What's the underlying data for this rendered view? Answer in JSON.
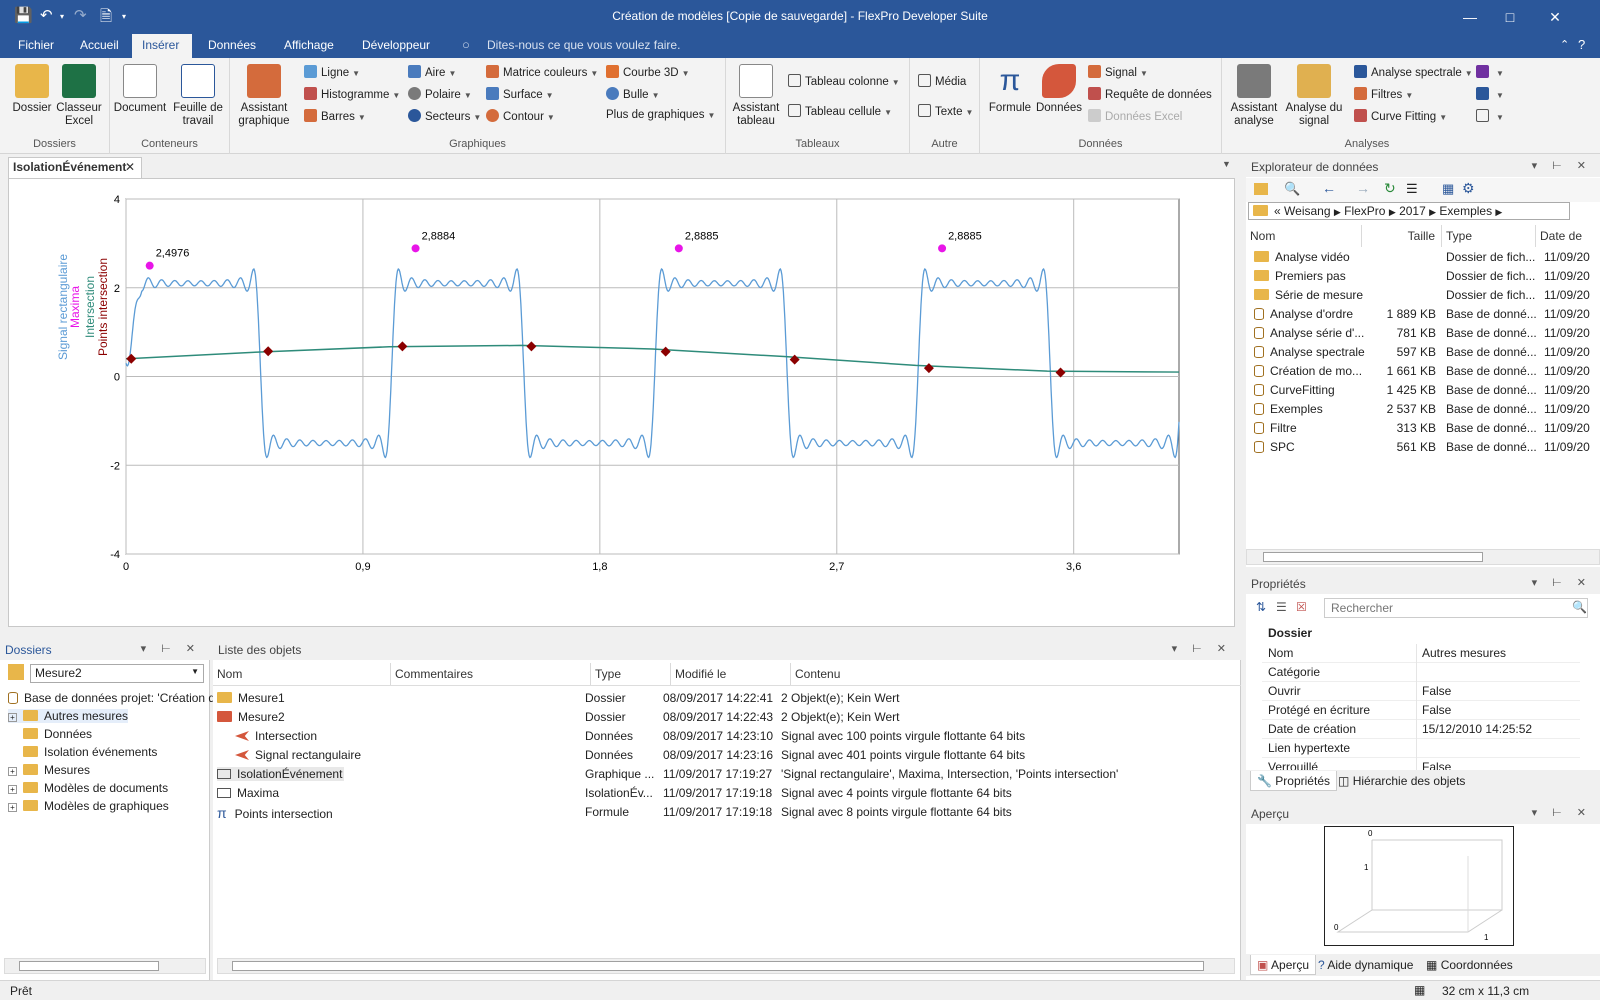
{
  "window": {
    "title": "Création de modèles [Copie de sauvegarde] - FlexPro Developer Suite"
  },
  "tabs": [
    "Fichier",
    "Accueil",
    "Insérer",
    "Données",
    "Affichage",
    "Développeur"
  ],
  "tellme": "Dites-nous ce que vous voulez faire.",
  "ribbon": {
    "dossiers": {
      "name": "Dossiers",
      "dossier": "Dossier",
      "classeur": "Classeur Excel"
    },
    "conteneurs": {
      "name": "Conteneurs",
      "document": "Document",
      "feuille": "Feuille de travail"
    },
    "graphiques": {
      "name": "Graphiques",
      "assistant": "Assistant graphique",
      "ligne": "Ligne",
      "histogramme": "Histogramme",
      "barres": "Barres",
      "aire": "Aire",
      "polaire": "Polaire",
      "secteurs": "Secteurs",
      "matrice": "Matrice couleurs",
      "surface": "Surface",
      "contour": "Contour",
      "courbe3d": "Courbe 3D",
      "bulle": "Bulle",
      "plus": "Plus de graphiques"
    },
    "tableaux": {
      "name": "Tableaux",
      "assistant": "Assistant tableau",
      "colonne": "Tableau colonne",
      "cellule": "Tableau cellule"
    },
    "autre": {
      "name": "Autre",
      "media": "Média",
      "texte": "Texte"
    },
    "donnees": {
      "name": "Données",
      "formule": "Formule",
      "donnees": "Données",
      "signal": "Signal",
      "requete": "Requête de données",
      "excel": "Données Excel"
    },
    "analyses": {
      "name": "Analyses",
      "assistant": "Assistant analyse",
      "signal": "Analyse du signal",
      "spectrale": "Analyse spectrale",
      "filtres": "Filtres",
      "curve": "Curve Fitting"
    }
  },
  "doc_tab": "IsolationÉvénement",
  "chart_data": {
    "type": "line",
    "legend": [
      "Signal rectangulaire",
      "Maxima",
      "Intersection",
      "Points intersection"
    ],
    "legend_colors": [
      "#5b9bd5",
      "#e815e8",
      "#2e8b7a",
      "#8b0000"
    ],
    "xticks": [
      "0",
      "0,9",
      "1,8",
      "2,7",
      "3,6"
    ],
    "yticks": [
      "4",
      "2",
      "0",
      "-2",
      "-4"
    ],
    "xlim": [
      0,
      4
    ],
    "ylim": [
      -4,
      4
    ],
    "period": 1,
    "duty": 0.5,
    "rise_start": 0.01,
    "high": 2.1,
    "low": -1.5,
    "maxima": [
      {
        "x": 0.09,
        "y": 2.4976,
        "label": "2,4976"
      },
      {
        "x": 1.1,
        "y": 2.8884,
        "label": "2,8884"
      },
      {
        "x": 2.1,
        "y": 2.8885,
        "label": "2,8885"
      },
      {
        "x": 3.1,
        "y": 2.8885,
        "label": "2,8885"
      }
    ],
    "intersection_curve": [
      [
        0,
        0.4
      ],
      [
        0.5,
        0.55
      ],
      [
        1,
        0.67
      ],
      [
        1.5,
        0.7
      ],
      [
        2,
        0.62
      ],
      [
        2.5,
        0.45
      ],
      [
        3,
        0.25
      ],
      [
        3.5,
        0.12
      ],
      [
        4,
        0.1
      ]
    ],
    "intersection_points": [
      [
        0.02,
        0.4
      ],
      [
        0.54,
        0.57
      ],
      [
        1.05,
        0.68
      ],
      [
        1.54,
        0.68
      ],
      [
        2.05,
        0.56
      ],
      [
        2.54,
        0.38
      ],
      [
        3.05,
        0.19
      ],
      [
        3.55,
        0.09
      ]
    ],
    "grid": true
  },
  "dossiers_pane": {
    "title": "Dossiers",
    "combo": "Mesure2",
    "root": "Base de données projet: 'Création de",
    "items": [
      "Autres mesures",
      "Données",
      "Isolation événements",
      "Mesures",
      "Modèles de documents",
      "Modèles de graphiques"
    ]
  },
  "objects_pane": {
    "title": "Liste des objets",
    "columns": [
      "Nom",
      "Commentaires",
      "Type",
      "Modifié le",
      "Contenu"
    ],
    "rows": [
      {
        "name": "Mesure1",
        "type": "Dossier",
        "date": "08/09/2017 14:22:41",
        "content": "2 Objekt(e); Kein Wert"
      },
      {
        "name": "Mesure2",
        "type": "Dossier",
        "date": "08/09/2017 14:22:43",
        "content": "2 Objekt(e); Kein Wert"
      },
      {
        "name": "Intersection",
        "type": "Données",
        "date": "08/09/2017 14:23:10",
        "content": "Signal avec 100 points virgule flottante 64 bits"
      },
      {
        "name": "Signal rectangulaire",
        "type": "Données",
        "date": "08/09/2017 14:23:16",
        "content": "Signal avec 401 points virgule flottante 64 bits"
      },
      {
        "name": "IsolationÉvénement",
        "type": "Graphique ...",
        "date": "11/09/2017 17:19:27",
        "content": "'Signal rectangulaire', Maxima, Intersection, 'Points intersection'"
      },
      {
        "name": "Maxima",
        "type": "IsolationÉv...",
        "date": "11/09/2017 17:19:18",
        "content": "Signal avec 4 points virgule flottante 64 bits"
      },
      {
        "name": "Points intersection",
        "type": "Formule",
        "date": "11/09/2017 17:19:18",
        "content": "Signal avec 8 points virgule flottante 64 bits"
      }
    ]
  },
  "explorer": {
    "title": "Explorateur de données",
    "crumbs": [
      "«",
      "Weisang",
      "FlexPro",
      "2017",
      "Exemples"
    ],
    "columns": [
      "Nom",
      "Taille",
      "Type",
      "Date de"
    ],
    "rows": [
      {
        "name": "Analyse vidéo",
        "size": "",
        "type": "Dossier de fich...",
        "date": "11/09/20"
      },
      {
        "name": "Premiers pas",
        "size": "",
        "type": "Dossier de fich...",
        "date": "11/09/20"
      },
      {
        "name": "Série de mesure",
        "size": "",
        "type": "Dossier de fich...",
        "date": "11/09/20"
      },
      {
        "name": "Analyse d'ordre",
        "size": "1 889 KB",
        "type": "Base de donné...",
        "date": "11/09/20"
      },
      {
        "name": "Analyse série d'...",
        "size": "781 KB",
        "type": "Base de donné...",
        "date": "11/09/20"
      },
      {
        "name": "Analyse spectrale",
        "size": "597 KB",
        "type": "Base de donné...",
        "date": "11/09/20"
      },
      {
        "name": "Création de mo...",
        "size": "1 661 KB",
        "type": "Base de donné...",
        "date": "11/09/20"
      },
      {
        "name": "CurveFitting",
        "size": "1 425 KB",
        "type": "Base de donné...",
        "date": "11/09/20"
      },
      {
        "name": "Exemples",
        "size": "2 537 KB",
        "type": "Base de donné...",
        "date": "11/09/20"
      },
      {
        "name": "Filtre",
        "size": "313 KB",
        "type": "Base de donné...",
        "date": "11/09/20"
      },
      {
        "name": "SPC",
        "size": "561 KB",
        "type": "Base de donné...",
        "date": "11/09/20"
      }
    ]
  },
  "properties": {
    "title": "Propriétés",
    "search": "Rechercher",
    "section": "Dossier",
    "rows": [
      {
        "k": "Nom",
        "v": "Autres mesures"
      },
      {
        "k": "Catégorie",
        "v": ""
      },
      {
        "k": "Ouvrir",
        "v": "False"
      },
      {
        "k": "Protégé en écriture",
        "v": "False"
      },
      {
        "k": "Date de création",
        "v": "15/12/2010 14:25:52"
      },
      {
        "k": "Lien hypertexte",
        "v": ""
      },
      {
        "k": "Verrouillé",
        "v": "False"
      }
    ],
    "tabs": [
      "Propriétés",
      "Hiérarchie des objets"
    ]
  },
  "apercu": {
    "title": "Aperçu",
    "tabs": [
      "Aperçu",
      "Aide dynamique",
      "Coordonnées"
    ],
    "labels": [
      "0",
      "1",
      "0",
      "1"
    ]
  },
  "status": {
    "left": "Prêt",
    "right": "32 cm x 11,3 cm"
  }
}
